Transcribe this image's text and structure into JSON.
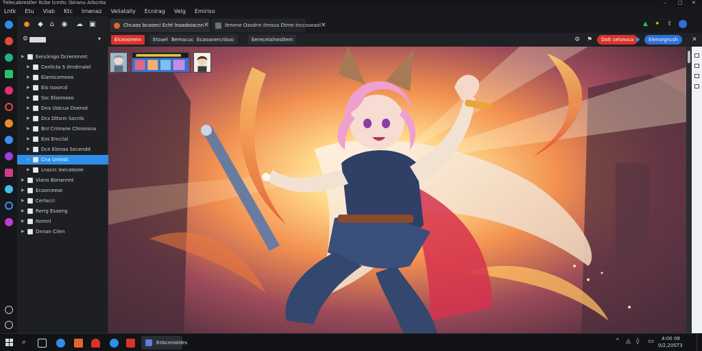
{
  "window": {
    "title": "Ƭelecabrestler Itcbe tcmhc (biranu Arbcnto"
  },
  "menu": [
    "Lntk",
    "Etu",
    "Viab",
    "Ktc",
    "Irnenaz",
    "Veliatally",
    "Ecnirag",
    "Velg",
    "Emiriso"
  ],
  "tabs": [
    {
      "label": "Chcaos bcaoeci Echt lnaadoiacnn",
      "active": true,
      "color": "#e8642c"
    },
    {
      "label": "Itmene Oasdnn Itmsus Dtme Inccoseaol",
      "active": false,
      "color": "#9aa0a8"
    }
  ],
  "bookmarks": [
    {
      "label": "Elceoorenn",
      "style": "red"
    },
    {
      "label": "Etoaelgese",
      "style": "plain"
    },
    {
      "label": "Bemacuclcs",
      "style": "plain"
    },
    {
      "label": "Ecaoanercnbuo",
      "style": "plain"
    },
    {
      "label": "Eerecelalnesltem",
      "style": "plain"
    }
  ],
  "nav_right": {
    "pill_red": "Dolt celsnoca",
    "pill_blue": "Elenorgncsh"
  },
  "sidebar": {
    "items": [
      {
        "label": "Eenckngo Dcrennnmt",
        "indent": 0
      },
      {
        "label": "Cenlicta S Ilrndrnalel",
        "indent": 1
      },
      {
        "label": "Elamicemneo",
        "indent": 1
      },
      {
        "label": "Eio Isoorcd",
        "indent": 1
      },
      {
        "label": "Ssc Elsoroseo",
        "indent": 1
      },
      {
        "label": "Dna Ustcua Doenot",
        "indent": 1
      },
      {
        "label": "Dcs Dltsnn Socnls",
        "indent": 1
      },
      {
        "label": "Bnl Crimane Chnonsna",
        "indent": 1
      },
      {
        "label": "Eos Encclal",
        "indent": 1
      },
      {
        "label": "Dce Elonaa Secendd",
        "indent": 1
      },
      {
        "label": "Cna Untodc",
        "indent": 1,
        "selected": true
      },
      {
        "label": "Lnocrc Ieecateole",
        "indent": 1
      },
      {
        "label": "Viano Bonannnt",
        "indent": 0
      },
      {
        "label": "Ecsorceese",
        "indent": 0
      },
      {
        "label": "Cerlacci",
        "indent": 0
      },
      {
        "label": "Rorrg Esaong",
        "indent": 0
      },
      {
        "label": "Itomnl",
        "indent": 0
      },
      {
        "label": "Dnnan Cilen",
        "indent": 0
      }
    ]
  },
  "taskbar": {
    "app_label": "Enbcenatdes",
    "tray_time": "4:00 08",
    "tray_date": "0/2,20ST3"
  },
  "colors": {
    "accent": "#2f8fe8",
    "tab_active": "#e8642c",
    "pill_red": "#d9342b",
    "pill_blue": "#2f6fd8"
  }
}
